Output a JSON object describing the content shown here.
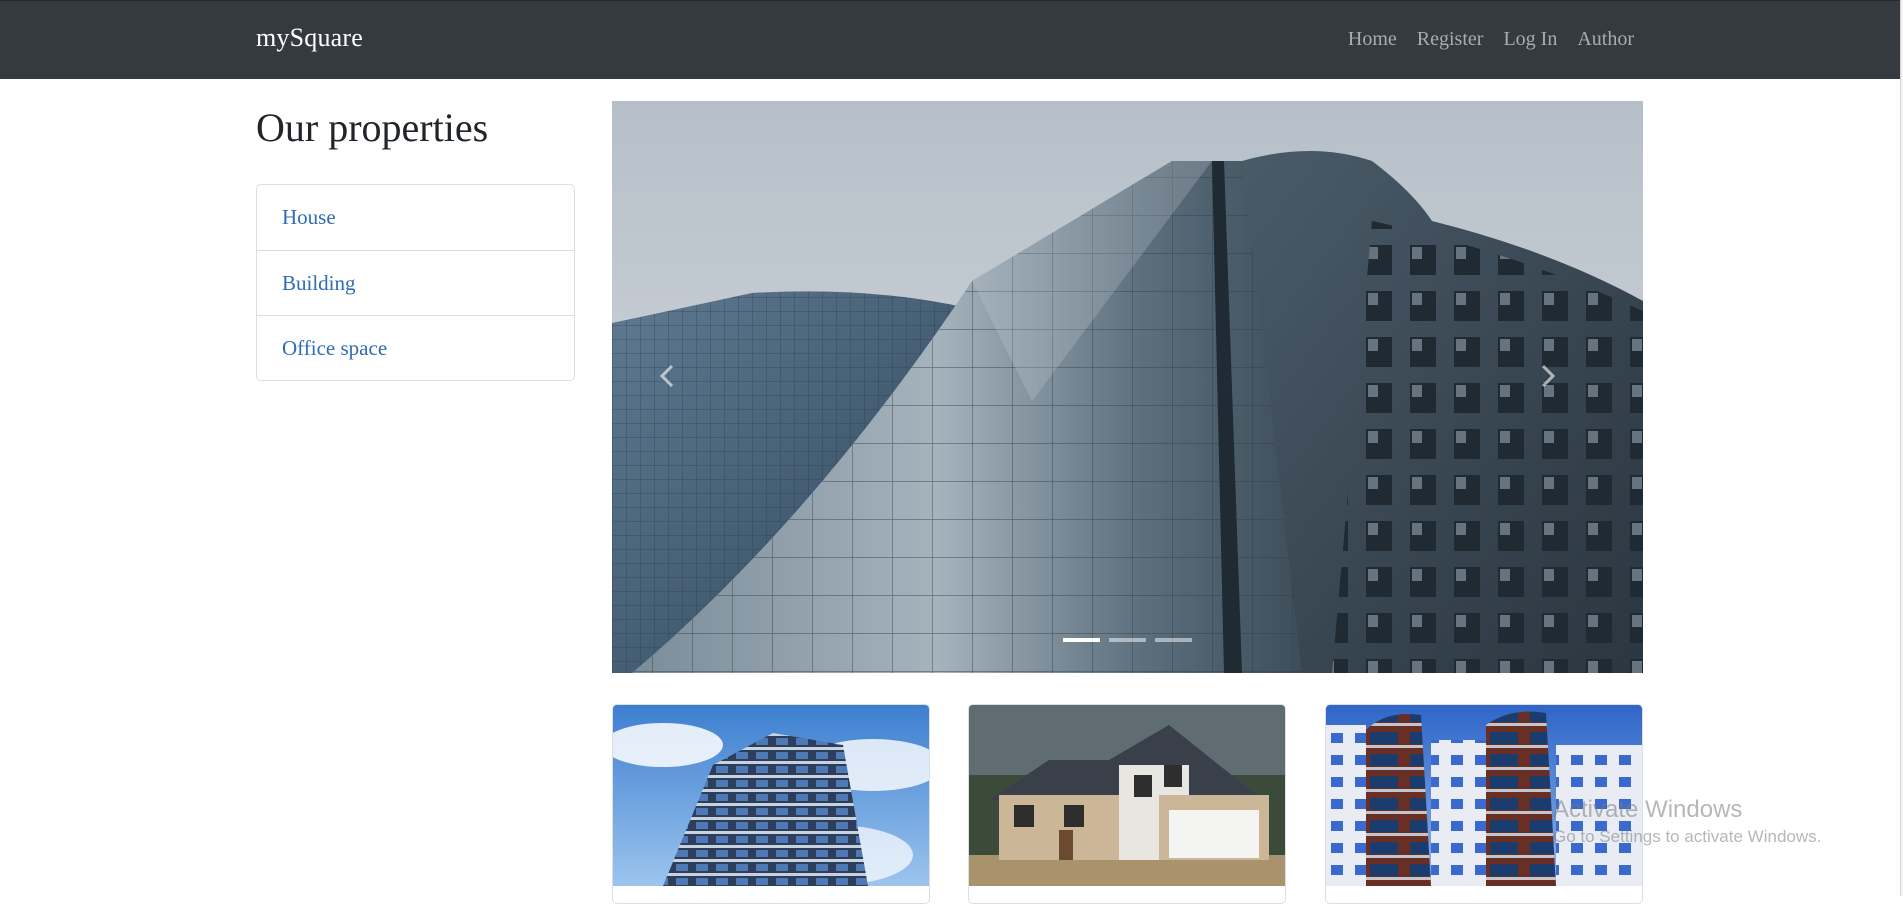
{
  "navbar": {
    "brand": "mySquare",
    "links": [
      "Home",
      "Register",
      "Log In",
      "Author"
    ]
  },
  "sidebar": {
    "title": "Our properties",
    "items": [
      "House",
      "Building",
      "Office space"
    ]
  },
  "carousel": {
    "slide_count": 3,
    "active_slide": 1,
    "image": "glass-skyscrapers-photo"
  },
  "cards": [
    {
      "image": "apartment-tower-photo"
    },
    {
      "image": "suburban-house-photo"
    },
    {
      "image": "residential-building-photo"
    }
  ],
  "watermark": {
    "title": "Activate Windows",
    "subtitle": "Go to Settings to activate Windows."
  },
  "colors": {
    "navbar_bg": "#343a40",
    "link_blue": "#2e6cb5",
    "nav_link": "#a8acb0"
  }
}
